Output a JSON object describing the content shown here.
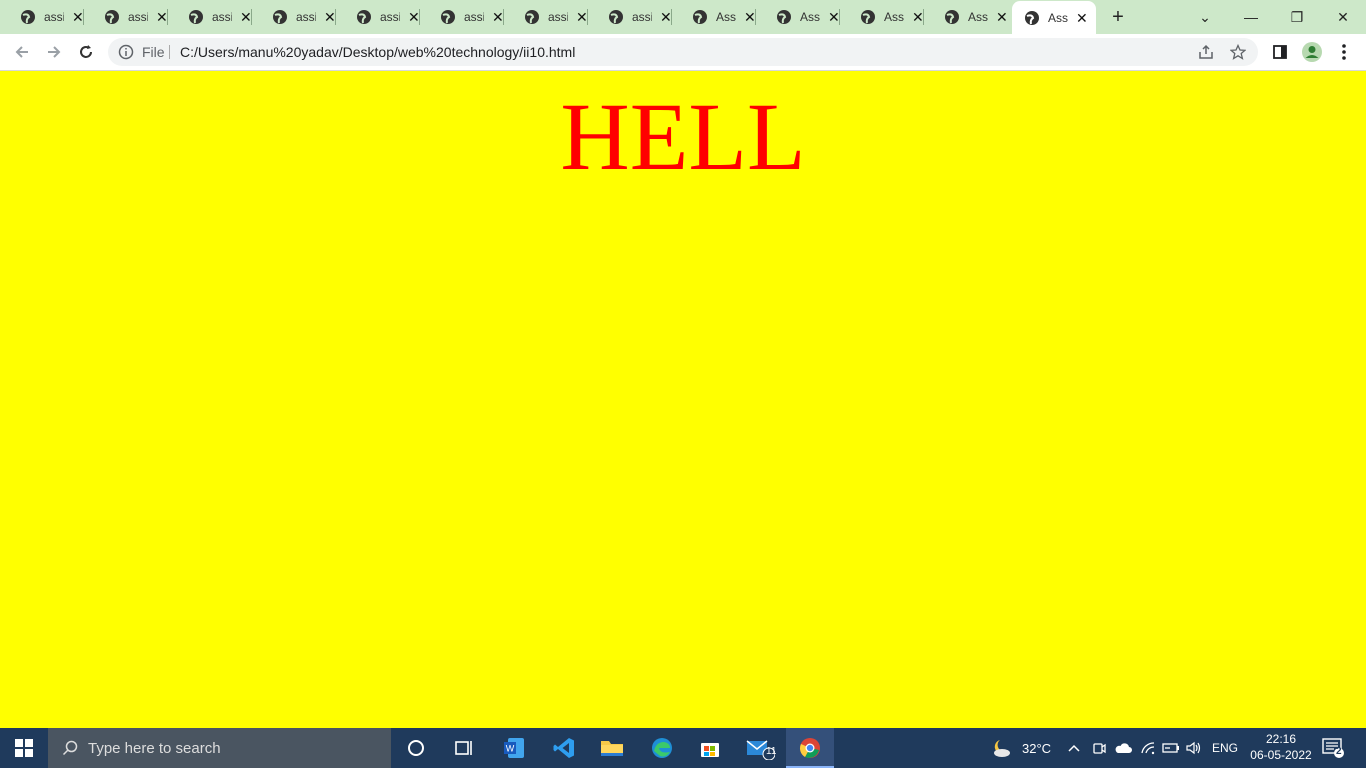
{
  "tabs": [
    {
      "label": "assi"
    },
    {
      "label": "assi"
    },
    {
      "label": "assi"
    },
    {
      "label": "assi"
    },
    {
      "label": "assi"
    },
    {
      "label": "assi"
    },
    {
      "label": "assi"
    },
    {
      "label": "assi"
    },
    {
      "label": "Ass"
    },
    {
      "label": "Ass"
    },
    {
      "label": "Ass"
    },
    {
      "label": "Ass"
    },
    {
      "label": "Ass"
    }
  ],
  "toolbar": {
    "scheme_label": "File",
    "url": "C:/Users/manu%20yadav/Desktop/web%20technology/ii10.html"
  },
  "page": {
    "heading": "HELL",
    "background_color": "#ffff00",
    "heading_color": "#ff0000"
  },
  "taskbar": {
    "search_placeholder": "Type here to search",
    "weather": "32°C",
    "language": "ENG",
    "time": "22:16",
    "date": "06-05-2022",
    "mail_badge": "11",
    "notifications_badge": "2"
  },
  "icons": {
    "back": "back-arrow-icon",
    "forward": "forward-arrow-icon",
    "reload": "reload-icon",
    "share": "share-icon",
    "star": "star-icon",
    "sidepanel": "side-panel-icon",
    "profile": "profile-icon",
    "menu": "kebab-menu-icon"
  }
}
